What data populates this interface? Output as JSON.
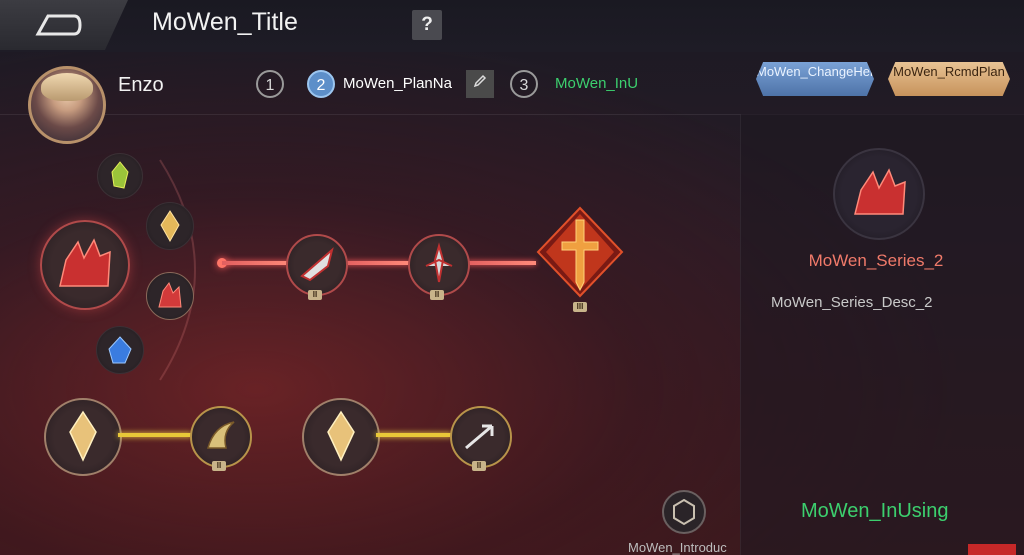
{
  "topbar": {
    "title": "MoWen_Title",
    "help": "?"
  },
  "hero": {
    "name": "Enzo"
  },
  "plans": {
    "p1": {
      "num": "1"
    },
    "p2": {
      "num": "2",
      "label": "MoWen_PlanNa"
    },
    "p3": {
      "num": "3",
      "label": "MoWen_InU"
    }
  },
  "buttons": {
    "change_hero": "MoWen_ChangeHero",
    "recommend_plan": "MoWen_RcmdPlan"
  },
  "side": {
    "series_name": "MoWen_Series_2",
    "series_desc": "MoWen_Series_Desc_2",
    "status": "MoWen_InUsing"
  },
  "bottom": {
    "intro_label": "MoWen_Introduc"
  },
  "tiers": {
    "t2": "II",
    "t3": "III"
  },
  "colors": {
    "accent_red": "#e25f5f",
    "accent_gold": "#e8c838",
    "in_use_green": "#3ccf6e",
    "active_blue": "#5d8fc9"
  }
}
